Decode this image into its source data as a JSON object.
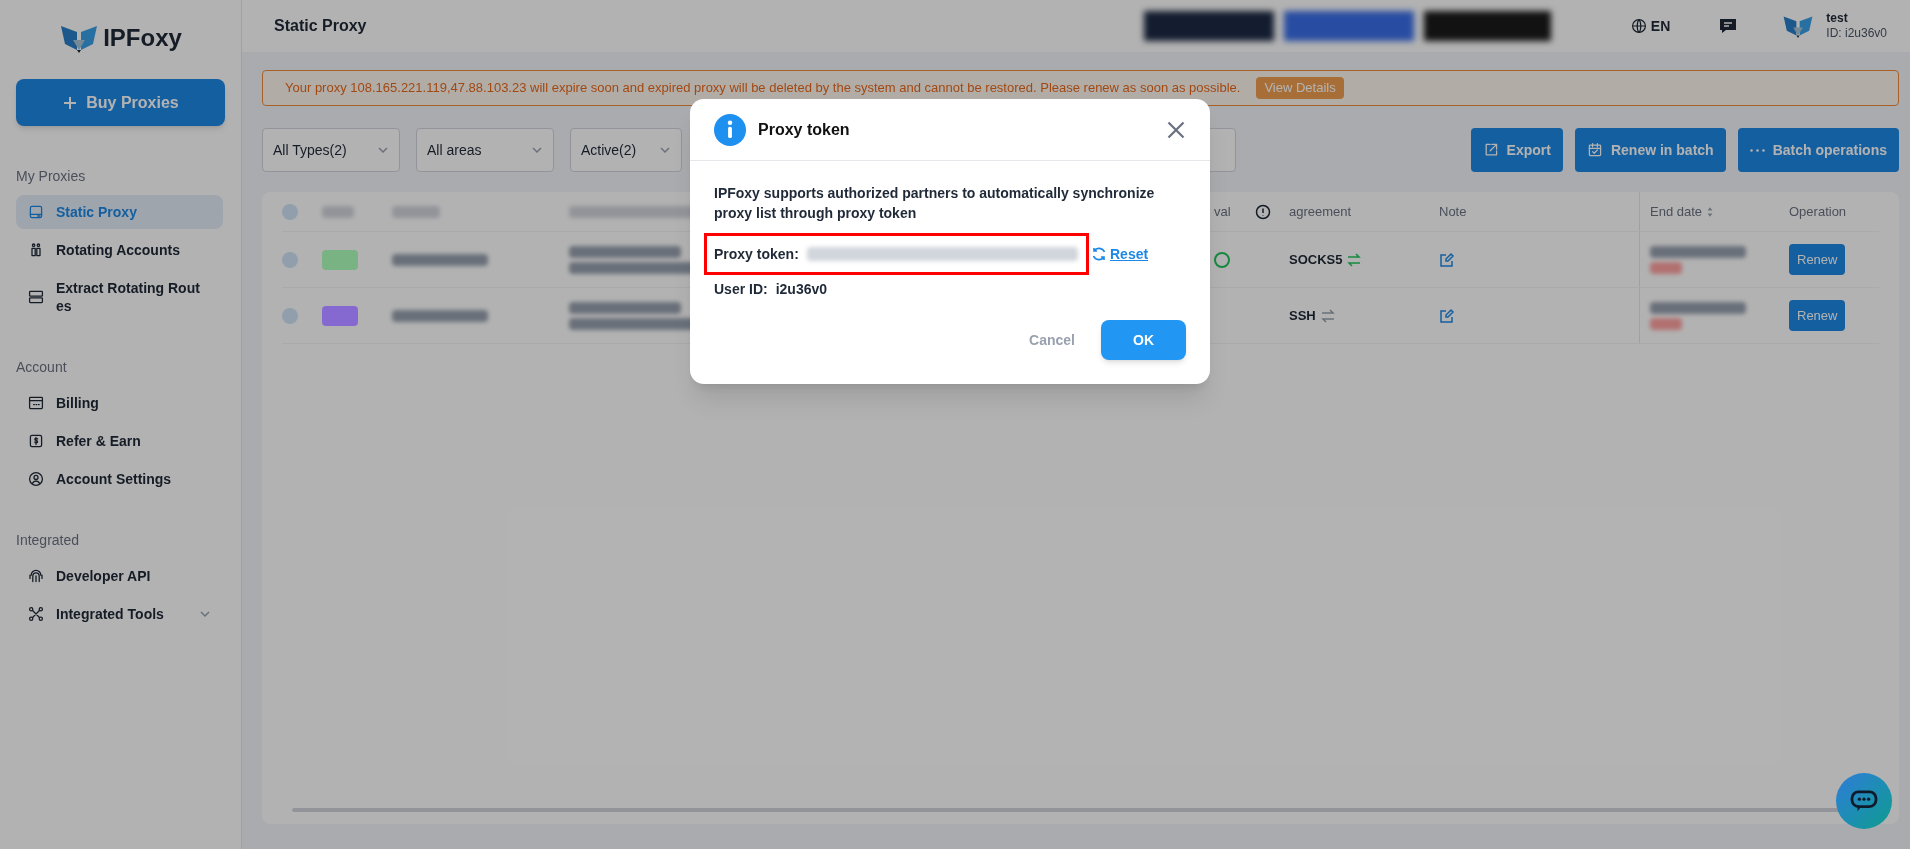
{
  "brand": {
    "name": "IPFoxy"
  },
  "buy_button": "Buy Proxies",
  "sidebar": {
    "sections": [
      {
        "title": "My Proxies",
        "items": [
          {
            "label": "Static Proxy",
            "selected": true
          },
          {
            "label": "Rotating Accounts",
            "selected": false
          },
          {
            "label": "Extract Rotating Rout es",
            "selected": false
          }
        ]
      },
      {
        "title": "Account",
        "items": [
          {
            "label": "Billing",
            "selected": false
          },
          {
            "label": "Refer & Earn",
            "selected": false
          },
          {
            "label": "Account Settings",
            "selected": false
          }
        ]
      },
      {
        "title": "Integrated",
        "items": [
          {
            "label": "Developer API",
            "selected": false
          },
          {
            "label": "Integrated Tools",
            "selected": false,
            "expandable": true
          }
        ]
      }
    ]
  },
  "header": {
    "title": "Static Proxy",
    "language": "EN",
    "user": {
      "name": "test",
      "id": "ID: i2u36v0"
    }
  },
  "alert": {
    "message": "Your proxy 108.165.221.119,47.88.103.23 will expire soon and expired proxy will be deleted by the system and cannot be restored. Please renew as soon as possible.",
    "action": "View Details"
  },
  "filters": [
    {
      "value": "All Types(2)"
    },
    {
      "value": "All areas"
    },
    {
      "value": "Active(2)"
    }
  ],
  "actions": [
    {
      "label": "Export"
    },
    {
      "label": "Renew in batch"
    },
    {
      "label": "Batch operations"
    }
  ],
  "table": {
    "select_all_checked": false,
    "columns": [
      "val",
      "agreement",
      "Note",
      "End date",
      "Operation"
    ],
    "rows": [
      {
        "checked": false,
        "color": "#79b283",
        "agreement": "SOCKS5",
        "swap_active": true,
        "status_ok": true,
        "action": "Renew"
      },
      {
        "checked": false,
        "color": "#8569d0",
        "agreement": "SSH",
        "swap_active": false,
        "status_ok": false,
        "action": "Renew"
      }
    ]
  },
  "dialog": {
    "title": "Proxy token",
    "description": "IPFoxy supports authorized partners to automatically synchronize proxy list through proxy token",
    "token_label": "Proxy token:",
    "reset": "Reset",
    "user_id_label": "User ID:",
    "user_id": "i2u36v0",
    "cancel": "Cancel",
    "ok": "OK"
  }
}
